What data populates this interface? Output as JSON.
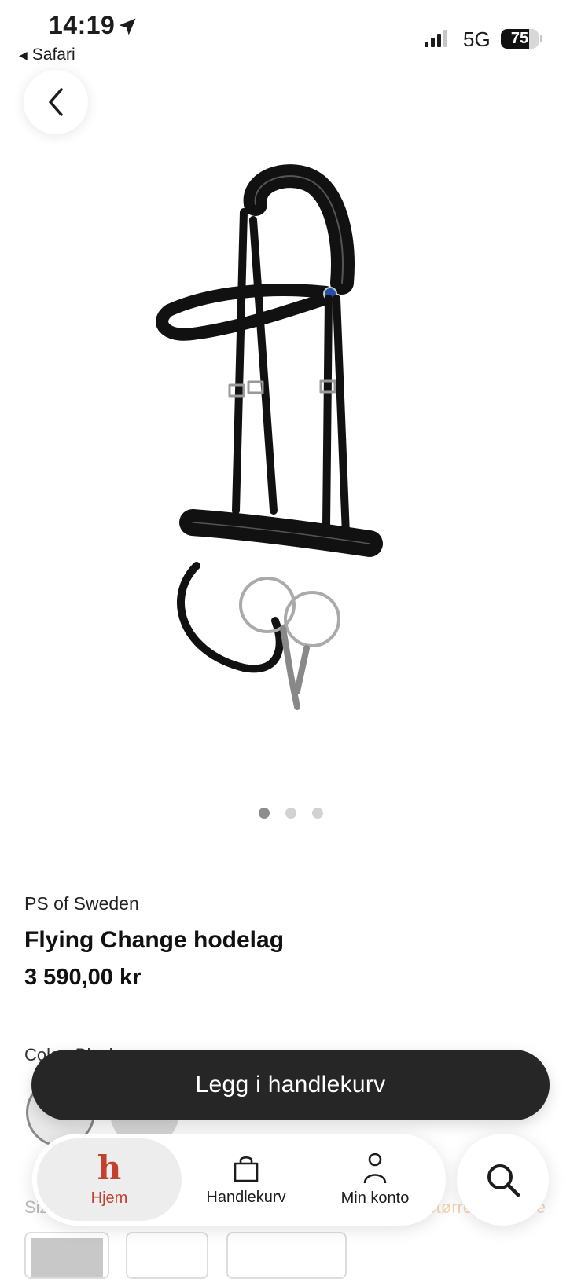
{
  "status_bar": {
    "time": "14:19",
    "back_app": "Safari",
    "network": "5G",
    "battery": "75",
    "battery_level": 0.75
  },
  "product": {
    "brand": "PS of Sweden",
    "title": "Flying Change hodelag",
    "price": "3 590,00 kr",
    "image_icon": "bridle-product-image",
    "gallery_count": 3,
    "gallery_active": 1
  },
  "options": {
    "color_label": "Color: Black",
    "size_label": "Size",
    "size_guide": "Størrelsesguide"
  },
  "actions": {
    "add_to_cart": "Legg i handlekurv"
  },
  "tabbar": {
    "items": [
      {
        "label": "Hjem",
        "icon": "h-logo-icon",
        "active": true
      },
      {
        "label": "Handlekurv",
        "icon": "shopping-bag-icon",
        "active": false
      },
      {
        "label": "Min konto",
        "icon": "person-icon",
        "active": false
      }
    ],
    "search_icon": "search-icon"
  },
  "colors": {
    "accent": "#c2412d",
    "button_dark": "#262626"
  }
}
